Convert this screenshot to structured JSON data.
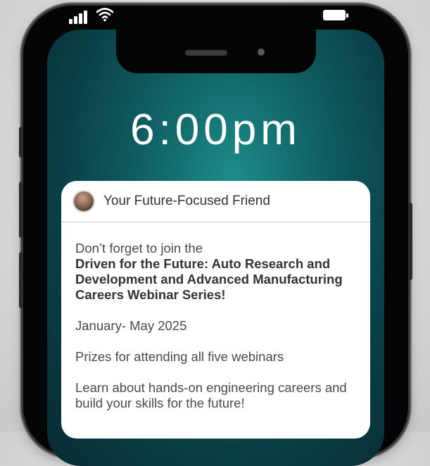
{
  "lockscreen": {
    "time": "6:00pm"
  },
  "status_bar": {
    "signal_icon": "signal-bars-icon",
    "wifi_icon": "wifi-icon",
    "battery_icon": "battery-icon"
  },
  "notification": {
    "sender": "Your Future-Focused Friend",
    "intro": "Don’t forget to join the",
    "headline": "Driven for the Future: Auto Research and Development and Advanced Manufacturing Careers Webinar Series!",
    "dates": "January- May 2025",
    "prizes": "Prizes for attending all five webinars",
    "description": "Learn about hands-on engineering careers and build your skills for the future!"
  },
  "colors": {
    "screen_teal": "#0f5f63",
    "card_background": "#ffffff",
    "text": "#4a4a4a"
  }
}
